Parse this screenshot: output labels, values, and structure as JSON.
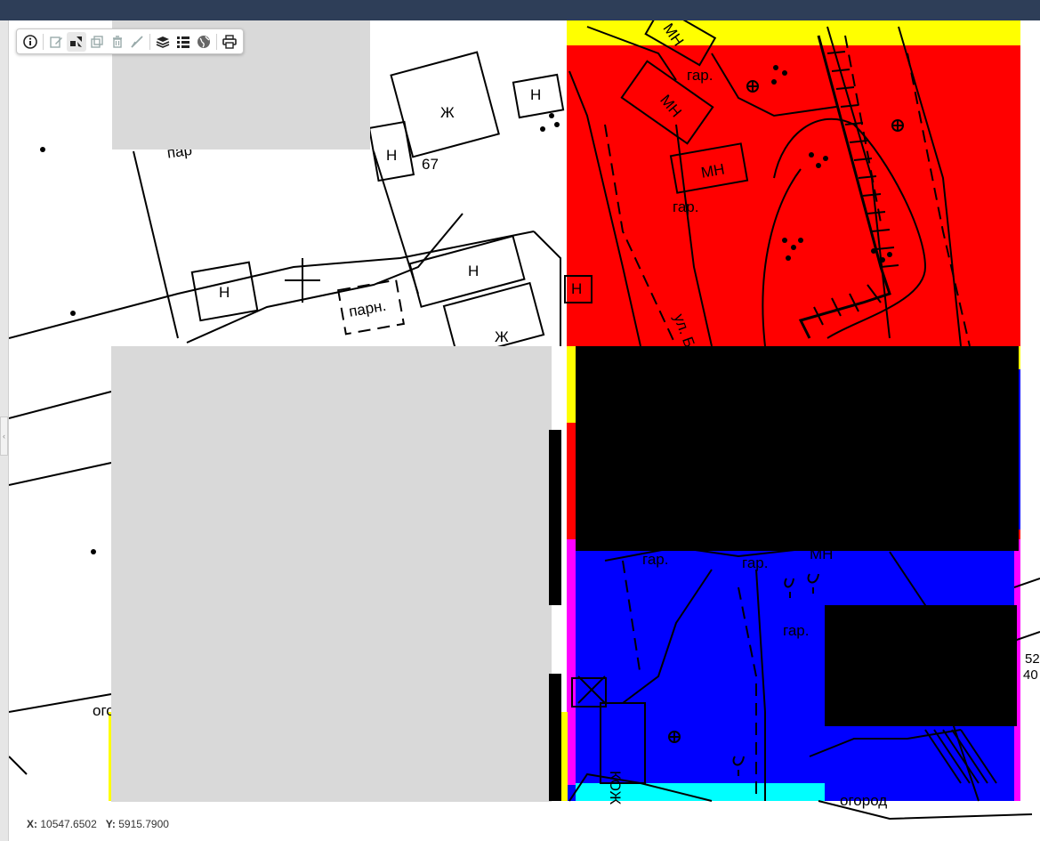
{
  "toolbar": {
    "buttons": [
      {
        "icon": "info-icon"
      },
      {
        "icon": "edit-icon"
      },
      {
        "icon": "select-features-icon"
      },
      {
        "icon": "copy-icon"
      },
      {
        "icon": "delete-icon"
      },
      {
        "icon": "measure-icon"
      },
      {
        "icon": "layers-icon"
      },
      {
        "icon": "legend-list-icon"
      },
      {
        "icon": "globe-icon"
      },
      {
        "icon": "print-icon"
      }
    ]
  },
  "coordinates": {
    "x_label": "X:",
    "x_value": "10547.6502",
    "y_label": "Y:",
    "y_value": "5915.7900"
  },
  "map": {
    "labels": {
      "mn1": "МН",
      "mn2": "МН",
      "mn3": "МН",
      "mn4": "МН",
      "gar1": "гар.",
      "gar2": "гар.",
      "gar3": "гар.",
      "gar4": "гар.",
      "gar5": "гар.",
      "zh1": "Ж",
      "zh2": "Ж",
      "n1": "Н",
      "n2": "Н",
      "n3": "Н",
      "n4": "Н",
      "n5": "Н",
      "num67": "67",
      "parn": "парн.",
      "ogorod": "огород",
      "ogo_partial": "ого",
      "kozh": "КОЖ",
      "street": "ул. Б",
      "par_partial": "пар",
      "edge_num1": "52",
      "edge_num2": "40"
    },
    "colors": {
      "red_zone": "#ff0000",
      "blue_zone": "#0000ff",
      "yellow_zone": "#ffff00",
      "cyan_zone": "#00ffff",
      "magenta_border": "#ff00ff",
      "redacted_black": "#000000",
      "redacted_gray": "#d9d9d9"
    }
  }
}
